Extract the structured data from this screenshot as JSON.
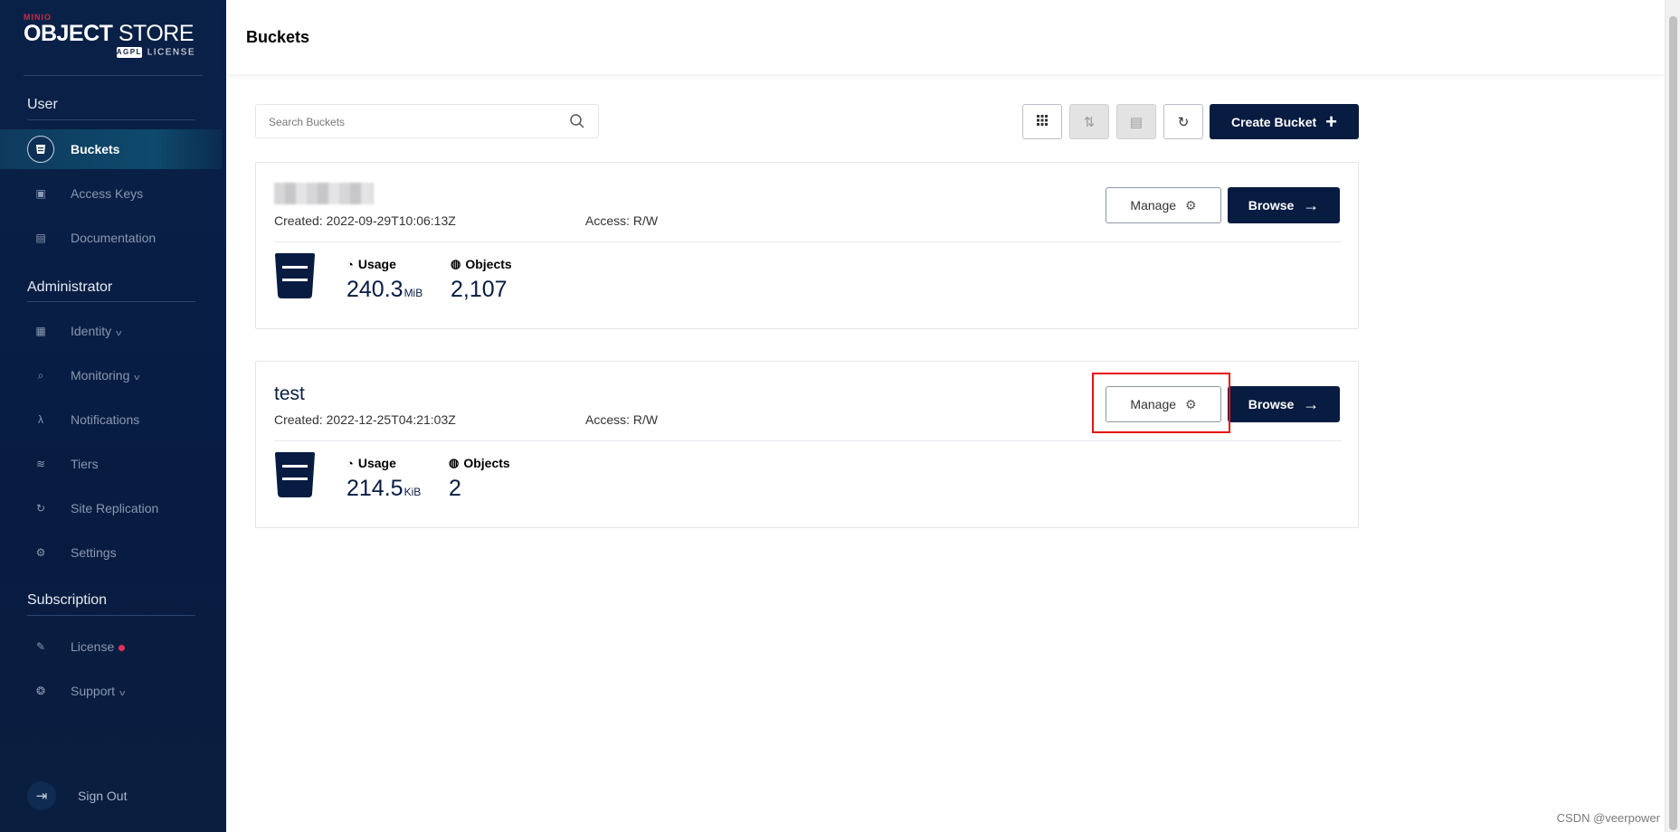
{
  "app": {
    "brand": "MINIO",
    "product_bold": "OBJECT",
    "product_rest": " STORE",
    "license_tag": "AGPL",
    "license_label": "LICENSE"
  },
  "sidebar": {
    "sections": {
      "user": "User",
      "administrator": "Administrator",
      "subscription": "Subscription"
    },
    "items": [
      {
        "label": "Buckets",
        "icon": "bucket-icon",
        "active": true
      },
      {
        "label": "Access Keys",
        "icon": "key-icon"
      },
      {
        "label": "Documentation",
        "icon": "document-icon"
      },
      {
        "label": "Identity",
        "icon": "identity-icon",
        "expandable": true
      },
      {
        "label": "Monitoring",
        "icon": "search-icon",
        "expandable": true
      },
      {
        "label": "Notifications",
        "icon": "lambda-icon"
      },
      {
        "label": "Tiers",
        "icon": "layers-icon"
      },
      {
        "label": "Site Replication",
        "icon": "sync-icon"
      },
      {
        "label": "Settings",
        "icon": "gear-icon"
      },
      {
        "label": "License",
        "icon": "license-icon",
        "badge": "red-dot"
      },
      {
        "label": "Support",
        "icon": "support-icon",
        "expandable": true
      }
    ],
    "sign_out": "Sign Out"
  },
  "header": {
    "title": "Buckets"
  },
  "toolbar": {
    "search_placeholder": "Search Buckets",
    "create_bucket": "Create Bucket"
  },
  "buckets": [
    {
      "name": "",
      "name_redacted": true,
      "created": "Created: 2022-09-29T10:06:13Z",
      "access": "Access: R/W",
      "usage_label": "Usage",
      "usage_value": "240.3",
      "usage_unit": "MiB",
      "objects_label": "Objects",
      "objects_value": "2,107",
      "manage": "Manage",
      "browse": "Browse"
    },
    {
      "name": "test",
      "created": "Created: 2022-12-25T04:21:03Z",
      "access": "Access: R/W",
      "usage_label": "Usage",
      "usage_value": "214.5",
      "usage_unit": "KiB",
      "objects_label": "Objects",
      "objects_value": "2",
      "manage": "Manage",
      "browse": "Browse"
    }
  ],
  "watermark": "CSDN @veerpower",
  "colors": {
    "sidebar_bg": "#081c42",
    "primary": "#081c42",
    "highlight": "#e8120c",
    "badge": "#e0325a"
  }
}
